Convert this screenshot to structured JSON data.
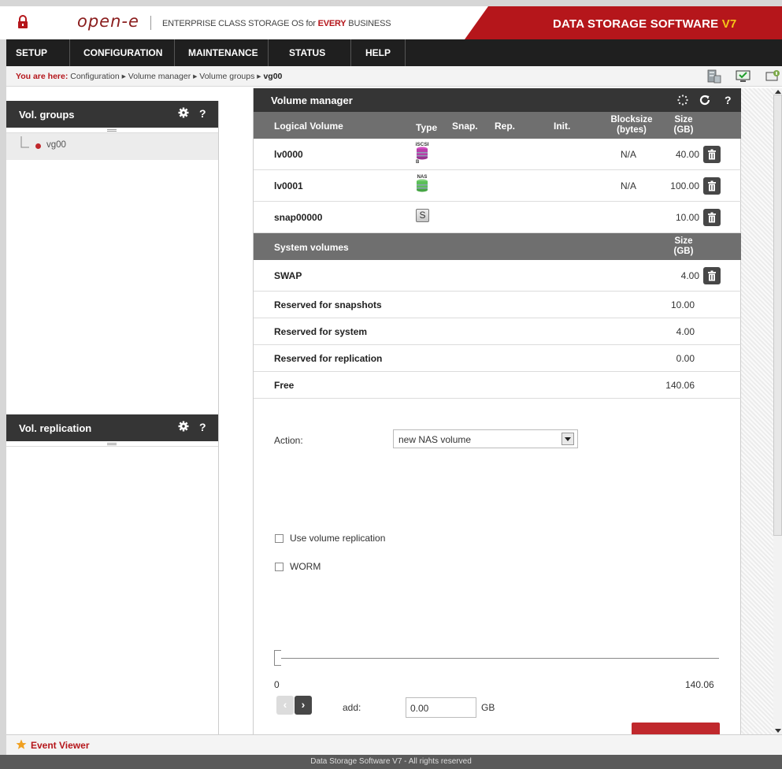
{
  "header": {
    "logo": "open-e",
    "tagline_prefix": "ENTERPRISE CLASS STORAGE OS for ",
    "tagline_highlight": "EVERY",
    "tagline_suffix": " BUSINESS",
    "product_title": "DATA STORAGE SOFTWARE ",
    "product_version": "V7",
    "accent_color": "#b5161b"
  },
  "nav": {
    "tabs": [
      {
        "label": "SETUP"
      },
      {
        "label": "CONFIGURATION"
      },
      {
        "label": "MAINTENANCE"
      },
      {
        "label": "STATUS"
      },
      {
        "label": "HELP"
      }
    ]
  },
  "breadcrumb": {
    "lead": "You are here:",
    "path": "Configuration ▸ Volume manager ▸ Volume groups ▸",
    "current": "vg00"
  },
  "left": {
    "vol_groups": {
      "title": "Vol. groups",
      "help": "?",
      "items": [
        {
          "label": "vg00"
        }
      ]
    },
    "vol_replication": {
      "title": "Vol. replication",
      "help": "?"
    }
  },
  "main": {
    "title": "Volume manager",
    "help": "?",
    "columns": {
      "logical_volume": "Logical Volume",
      "type": "Type",
      "snap": "Snap.",
      "rep": "Rep.",
      "init": "Init.",
      "blocksize_1": "Blocksize",
      "blocksize_2": "(bytes)",
      "size_1": "Size",
      "size_2": "(GB)"
    },
    "volumes": [
      {
        "name": "lv0000",
        "type_icon": "iscsi-volume-icon",
        "type_label": "iSCSI",
        "type_sub": "B",
        "blocksize": "N/A",
        "size": "40.00"
      },
      {
        "name": "lv0001",
        "type_icon": "nas-volume-icon",
        "type_label": "NAS",
        "blocksize": "N/A",
        "size": "100.00"
      },
      {
        "name": "snap00000",
        "type_icon": "snapshot-icon",
        "type_label": "S",
        "blocksize": "",
        "size": "10.00"
      }
    ],
    "system": {
      "header": "System volumes",
      "size_1": "Size",
      "size_2": "(GB)",
      "rows": [
        {
          "name": "SWAP",
          "size": "4.00"
        },
        {
          "name": "Reserved for snapshots",
          "size": "10.00"
        },
        {
          "name": "Reserved for system",
          "size": "4.00"
        },
        {
          "name": "Reserved for replication",
          "size": "0.00"
        },
        {
          "name": "Free",
          "size": "140.06"
        }
      ]
    },
    "form": {
      "action_label": "Action:",
      "action_value": "new NAS volume",
      "use_replication": "Use volume replication",
      "worm": "WORM",
      "slider_min": "0",
      "slider_max": "140.06",
      "slider_value": 0,
      "add_label": "add:",
      "add_value": "0.00",
      "unit": "GB"
    }
  },
  "event_viewer": {
    "label": "Event Viewer"
  },
  "footer": {
    "text": "Data Storage Software V7 - All rights reserved"
  }
}
